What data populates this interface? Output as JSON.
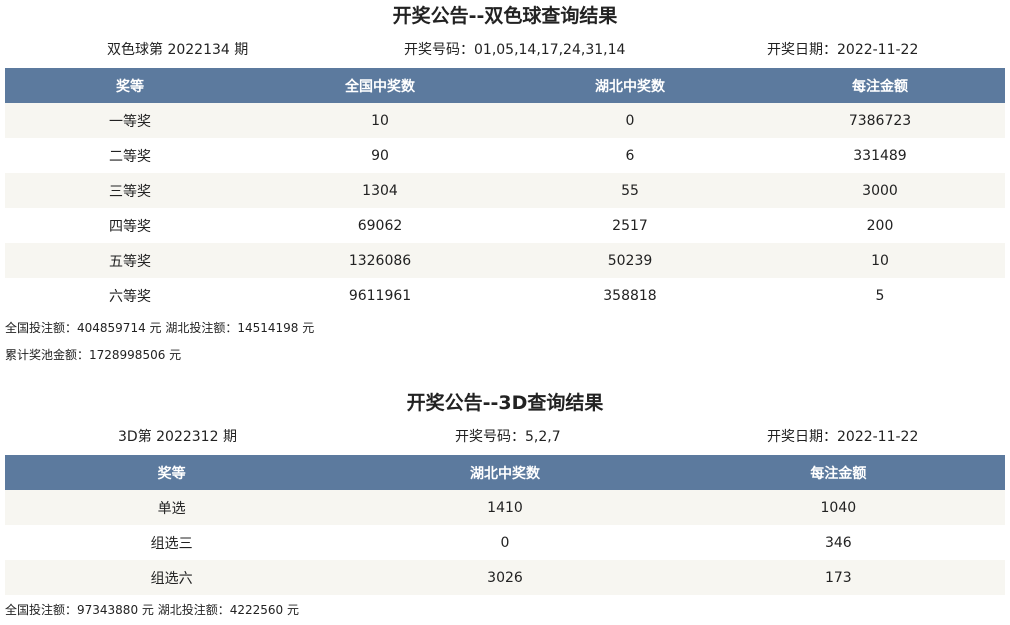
{
  "ssq": {
    "title": "开奖公告--双色球查询结果",
    "issue": "双色球第 2022134 期",
    "numbers": "开奖号码：01,05,14,17,24,31,14",
    "date": "开奖日期：2022-11-22",
    "headers": [
      "奖等",
      "全国中奖数",
      "湖北中奖数",
      "每注金额"
    ],
    "rows": [
      [
        "一等奖",
        "10",
        "0",
        "7386723"
      ],
      [
        "二等奖",
        "90",
        "6",
        "331489"
      ],
      [
        "三等奖",
        "1304",
        "55",
        "3000"
      ],
      [
        "四等奖",
        "69062",
        "2517",
        "200"
      ],
      [
        "五等奖",
        "1326086",
        "50239",
        "10"
      ],
      [
        "六等奖",
        "9611961",
        "358818",
        "5"
      ]
    ],
    "bets": "全国投注额：404859714 元 湖北投注额：14514198 元",
    "pool": "累计奖池金额：1728998506 元"
  },
  "fc3d": {
    "title": "开奖公告--3D查询结果",
    "issue": "3D第 2022312 期",
    "numbers": "开奖号码：5,2,7",
    "date": "开奖日期：2022-11-22",
    "headers": [
      "奖等",
      "湖北中奖数",
      "每注金额"
    ],
    "rows": [
      [
        "单选",
        "1410",
        "1040"
      ],
      [
        "组选三",
        "0",
        "346"
      ],
      [
        "组选六",
        "3026",
        "173"
      ]
    ],
    "bets": "全国投注额：97343880 元 湖北投注额：4222560 元"
  },
  "colors": {
    "header_bg": "#5c7a9e",
    "row_alt_bg": "#f7f6f1"
  }
}
